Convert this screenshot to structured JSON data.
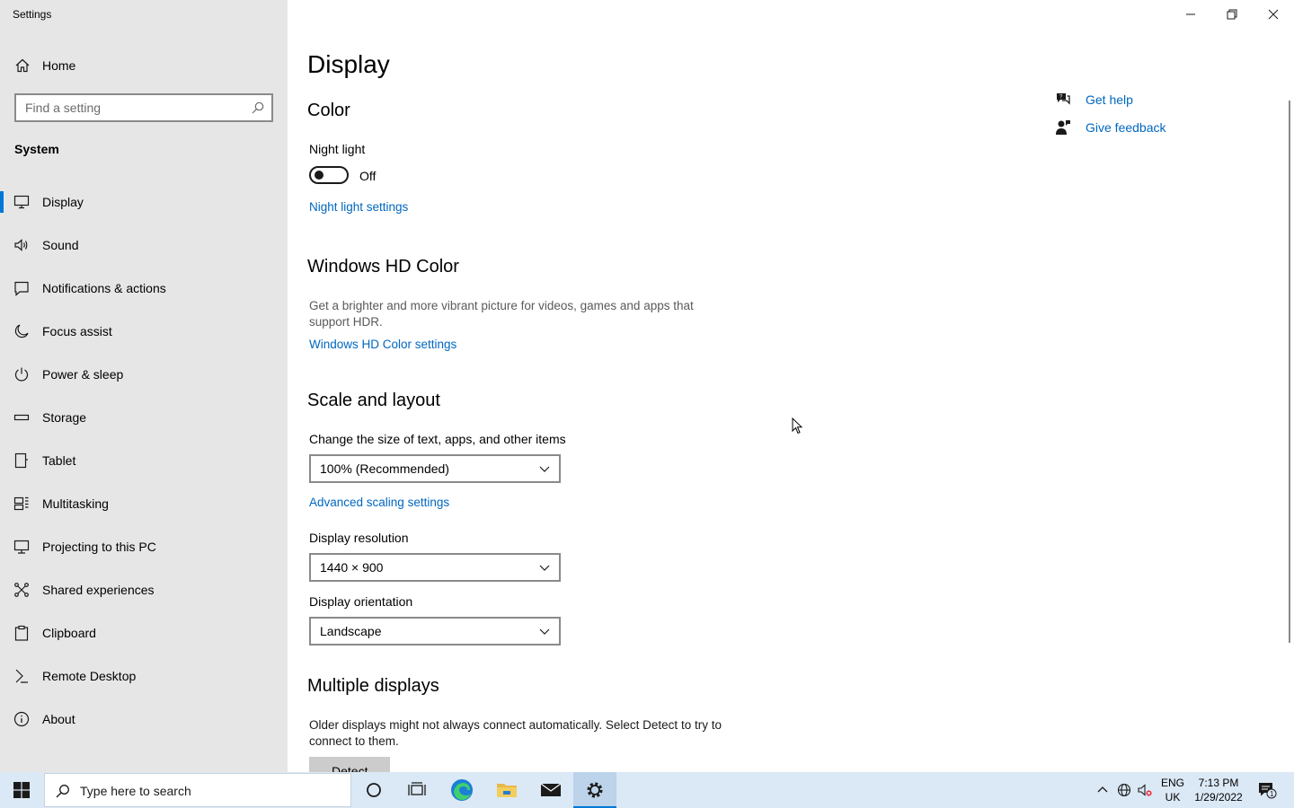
{
  "window": {
    "title": "Settings"
  },
  "sidebar": {
    "home_label": "Home",
    "search_placeholder": "Find a setting",
    "section_label": "System",
    "items": [
      {
        "label": "Display",
        "icon": "monitor-icon",
        "active": true
      },
      {
        "label": "Sound",
        "icon": "speaker-icon"
      },
      {
        "label": "Notifications & actions",
        "icon": "notification-icon"
      },
      {
        "label": "Focus assist",
        "icon": "moon-icon"
      },
      {
        "label": "Power & sleep",
        "icon": "power-icon"
      },
      {
        "label": "Storage",
        "icon": "storage-icon"
      },
      {
        "label": "Tablet",
        "icon": "tablet-icon"
      },
      {
        "label": "Multitasking",
        "icon": "multitasking-icon"
      },
      {
        "label": "Projecting to this PC",
        "icon": "projector-icon"
      },
      {
        "label": "Shared experiences",
        "icon": "shared-icon"
      },
      {
        "label": "Clipboard",
        "icon": "clipboard-icon"
      },
      {
        "label": "Remote Desktop",
        "icon": "remote-desktop-icon"
      },
      {
        "label": "About",
        "icon": "info-icon"
      }
    ]
  },
  "main": {
    "title": "Display",
    "color": {
      "heading": "Color",
      "night_light_label": "Night light",
      "night_light_state": "Off",
      "night_light_link": "Night light settings"
    },
    "hdr": {
      "heading": "Windows HD Color",
      "description": "Get a brighter and more vibrant picture for videos, games and apps that support HDR.",
      "link": "Windows HD Color settings"
    },
    "scale": {
      "heading": "Scale and layout",
      "size_label": "Change the size of text, apps, and other items",
      "size_value": "100% (Recommended)",
      "advanced_link": "Advanced scaling settings",
      "resolution_label": "Display resolution",
      "resolution_value": "1440 × 900",
      "orientation_label": "Display orientation",
      "orientation_value": "Landscape"
    },
    "multiple": {
      "heading": "Multiple displays",
      "description": "Older displays might not always connect automatically. Select Detect to try to connect to them.",
      "detect_label": "Detect"
    }
  },
  "help": {
    "get_help": "Get help",
    "give_feedback": "Give feedback"
  },
  "taskbar": {
    "search_placeholder": "Type here to search",
    "lang_top": "ENG",
    "lang_bottom": "UK",
    "time": "7:13 PM",
    "date": "1/29/2022",
    "notification_count": "1"
  },
  "colors": {
    "accent": "#0078d7",
    "link": "#0067c0",
    "sidebar_bg": "#e6e6e6",
    "taskbar_bg": "#dbe8f5"
  }
}
